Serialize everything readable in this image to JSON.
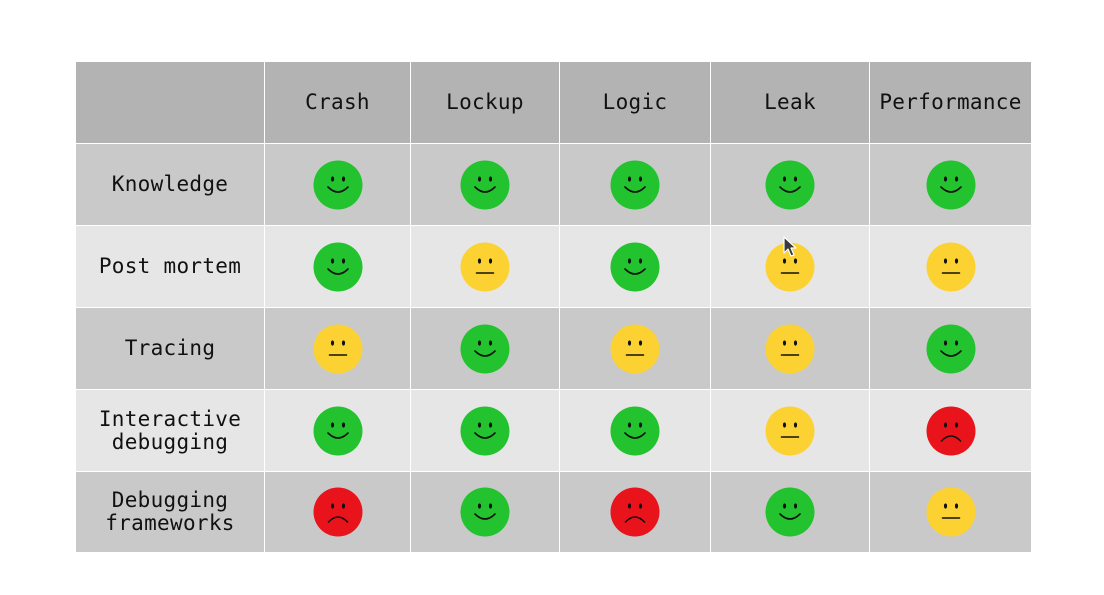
{
  "columns": [
    "",
    "Crash",
    "Lockup",
    "Logic",
    "Leak",
    "Performance"
  ],
  "rows": [
    {
      "label": "Knowledge",
      "ratings": [
        "good",
        "good",
        "good",
        "good",
        "good"
      ]
    },
    {
      "label": "Post mortem",
      "ratings": [
        "good",
        "neutral",
        "good",
        "neutral",
        "neutral"
      ]
    },
    {
      "label": "Tracing",
      "ratings": [
        "neutral",
        "good",
        "neutral",
        "neutral",
        "good"
      ]
    },
    {
      "label": "Interactive\ndebugging",
      "ratings": [
        "good",
        "good",
        "good",
        "neutral",
        "bad"
      ]
    },
    {
      "label": "Debugging\nframeworks",
      "ratings": [
        "bad",
        "good",
        "bad",
        "good",
        "neutral"
      ]
    }
  ],
  "rating_icons": {
    "good": "happy-face-icon",
    "neutral": "neutral-face-icon",
    "bad": "sad-face-icon"
  },
  "colors": {
    "good": "#22c32e",
    "neutral": "#fcd232",
    "bad": "#e8131b",
    "header_bg": "#b3b3b3",
    "row_dark_bg": "#c9c9c9",
    "row_light_bg": "#e6e6e6"
  }
}
